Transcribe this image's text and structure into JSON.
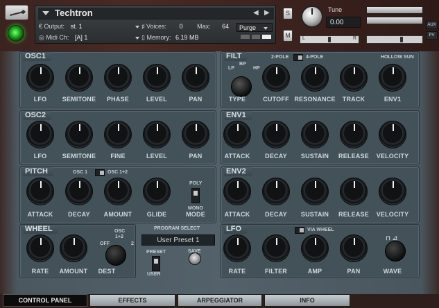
{
  "header": {
    "instrument_name": "Techtron",
    "output_label": "Output:",
    "output_value": "st. 1",
    "voices_label": "Voices:",
    "voices_value": "0",
    "max_label": "Max:",
    "max_value": "64",
    "midi_label": "Midi Ch:",
    "midi_value": "[A]  1",
    "memory_label": "Memory:",
    "memory_value": "6.19 MB",
    "purge_label": "Purge",
    "s_label": "S",
    "m_label": "M",
    "tune_label": "Tune",
    "tune_value": "0.00",
    "aux_label": "AUX",
    "pv_label": "PV",
    "pan_left": "L",
    "pan_right": "R"
  },
  "sections": {
    "osc1": {
      "title": "OSC1",
      "knobs": [
        "LFO",
        "SEMITONE",
        "PHASE",
        "LEVEL",
        "PAN"
      ]
    },
    "osc2": {
      "title": "OSC2",
      "knobs": [
        "LFO",
        "SEMITONE",
        "FINE",
        "LEVEL",
        "PAN"
      ]
    },
    "filt": {
      "title": "FILT",
      "two_pole": "2-POLE",
      "four_pole": "4-POLE",
      "hollow_sun": "HOLLOW SUN",
      "type_lp": "LP",
      "type_bp": "BP",
      "type_hp": "HP",
      "knobs": [
        "TYPE",
        "CUTOFF",
        "RESONANCE",
        "TRACK",
        "ENV1"
      ]
    },
    "env1": {
      "title": "ENV1",
      "knobs": [
        "ATTACK",
        "DECAY",
        "SUSTAIN",
        "RELEASE",
        "VELOCITY"
      ]
    },
    "pitch": {
      "title": "PITCH",
      "osc1": "OSC 1",
      "osc12": "OSC 1+2",
      "poly": "POLY",
      "mono": "MONO",
      "knobs": [
        "ATTACK",
        "DECAY",
        "AMOUNT",
        "GLIDE",
        "MODE"
      ]
    },
    "env2": {
      "title": "ENV2",
      "knobs": [
        "ATTACK",
        "DECAY",
        "SUSTAIN",
        "RELEASE",
        "VELOCITY"
      ]
    },
    "wheel": {
      "title": "WHEEL",
      "osc": "OSC",
      "one_two": "1+2",
      "off": "OFF",
      "two": "2",
      "knobs": [
        "RATE",
        "AMOUNT",
        "DEST"
      ]
    },
    "program": {
      "title": "PROGRAM SELECT",
      "preset_value": "User Preset 1",
      "preset": "PRESET",
      "user": "USER",
      "save": "SAVE"
    },
    "lfo": {
      "title": "LFO",
      "via_wheel": "VIA WHEEL",
      "knobs": [
        "RATE",
        "FILTER",
        "AMP",
        "PAN",
        "WAVE"
      ]
    }
  },
  "tabs": [
    "CONTROL PANEL",
    "EFFECTS",
    "ARPEGGIATOR",
    "INFO"
  ],
  "active_tab": "CONTROL PANEL"
}
